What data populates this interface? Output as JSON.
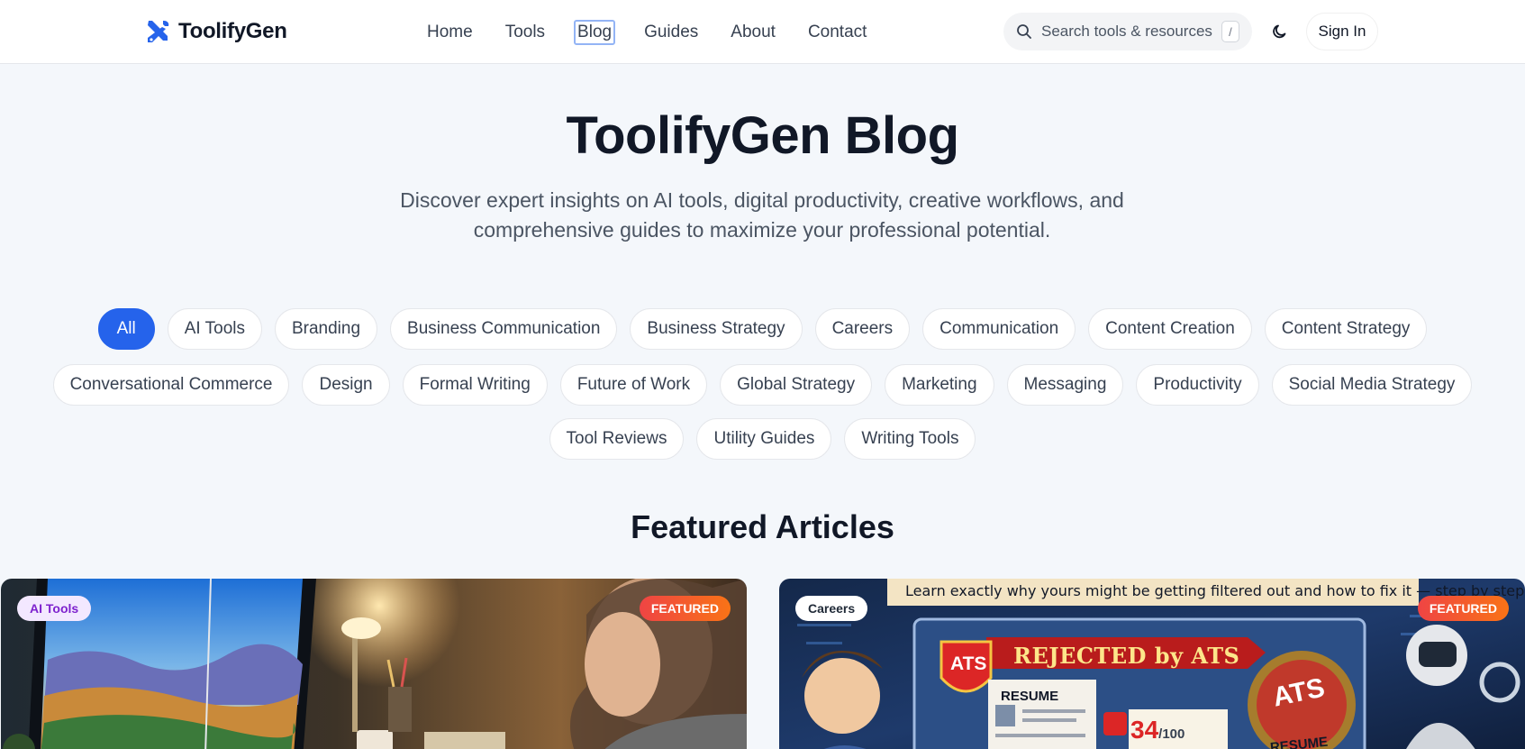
{
  "brand": {
    "name": "ToolifyGen",
    "accent": "#2563eb"
  },
  "nav": {
    "items": [
      {
        "label": "Home"
      },
      {
        "label": "Tools"
      },
      {
        "label": "Blog"
      },
      {
        "label": "Guides"
      },
      {
        "label": "About"
      },
      {
        "label": "Contact"
      }
    ],
    "active": "Blog"
  },
  "search": {
    "placeholder": "Search tools & resources",
    "shortcut": "/"
  },
  "header_actions": {
    "theme_icon": "moon-icon",
    "signin_label": "Sign In"
  },
  "hero": {
    "title": "ToolifyGen Blog",
    "subtitle": "Discover expert insights on AI tools, digital productivity, creative workflows, and comprehensive guides to maximize your professional potential."
  },
  "categories": {
    "selected": "All",
    "rows": [
      [
        "All",
        "AI Tools",
        "Branding",
        "Business Communication",
        "Business Strategy",
        "Careers",
        "Communication",
        "Content Creation",
        "Content Strategy"
      ],
      [
        "Conversational Commerce",
        "Design",
        "Formal Writing",
        "Future of Work",
        "Global Strategy",
        "Marketing",
        "Messaging",
        "Productivity",
        "Social Media Strategy"
      ],
      [
        "Tool Reviews",
        "Utility Guides",
        "Writing Tools"
      ]
    ]
  },
  "featured": {
    "heading": "Featured Articles",
    "cards": [
      {
        "category": "AI Tools",
        "badge": "FEATURED"
      },
      {
        "category": "Careers",
        "badge": "FEATURED",
        "image_text": {
          "banner": "Learn exactly why yours might be getting filtered out and how to fix it — step by step.",
          "headline": "REJECTED by ATS",
          "shield": "ATS",
          "resume": "RESUME",
          "score": "34",
          "score_suffix": "/100",
          "seal": "ATS"
        }
      }
    ]
  }
}
